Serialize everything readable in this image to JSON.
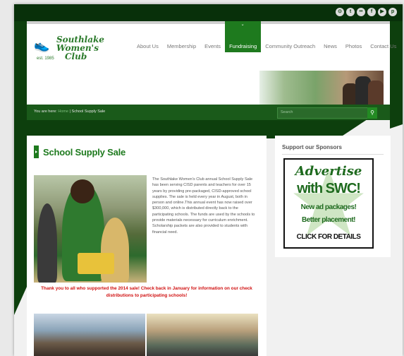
{
  "colors": {
    "brand_green": "#1e7a1e",
    "dark_green": "#0d3f0d",
    "alert_red": "#d01010"
  },
  "social": [
    {
      "icon": "rss-icon",
      "glyph": "⊙"
    },
    {
      "icon": "twitter-icon",
      "glyph": "t"
    },
    {
      "icon": "flickr-icon",
      "glyph": "••"
    },
    {
      "icon": "facebook-icon",
      "glyph": "f"
    },
    {
      "icon": "youtube-icon",
      "glyph": "▶"
    },
    {
      "icon": "pinterest-icon",
      "glyph": "p"
    }
  ],
  "logo": {
    "line1": "Southlake",
    "line2": "Women's",
    "line3": "Club",
    "est": "est. 1985"
  },
  "nav": [
    {
      "label": "About Us"
    },
    {
      "label": "Membership"
    },
    {
      "label": "Events"
    },
    {
      "label": "Fundraising",
      "active": true
    },
    {
      "label": "Community Outreach"
    },
    {
      "label": "News"
    },
    {
      "label": "Photos"
    },
    {
      "label": "Contact Us"
    }
  ],
  "breadcrumb": {
    "prefix": "You are here:",
    "home": "Home",
    "sep": " | ",
    "current": "School Supply Sale"
  },
  "search": {
    "placeholder": "Search"
  },
  "content": {
    "title": "School Supply Sale",
    "paragraph": "The Southlake Women's Club annual School Supply Sale has been serving CISD parents and teachers for over 15 years by providing pre-packaged, CISD-approved school supplies. The sale is held every year in August, both in person and online.This annual event has now raised over $300,000, which is distributed directly back to the participating schools. The funds are used by the schools to provide materials necessary for curriculum enrichment. Scholarship packets are also provided to students with financial need.",
    "thanks": "Thank you to all who supported the 2014 sale! Check back in January for information on our check distributions to participating schools!"
  },
  "sidebar": {
    "title": "Support our Sponsors",
    "ad": {
      "line1": "Advertise",
      "line2": "with SWC!",
      "line3": "New ad packages!",
      "line4": "Better placement!",
      "line5": "CLICK FOR DETAILS"
    }
  }
}
